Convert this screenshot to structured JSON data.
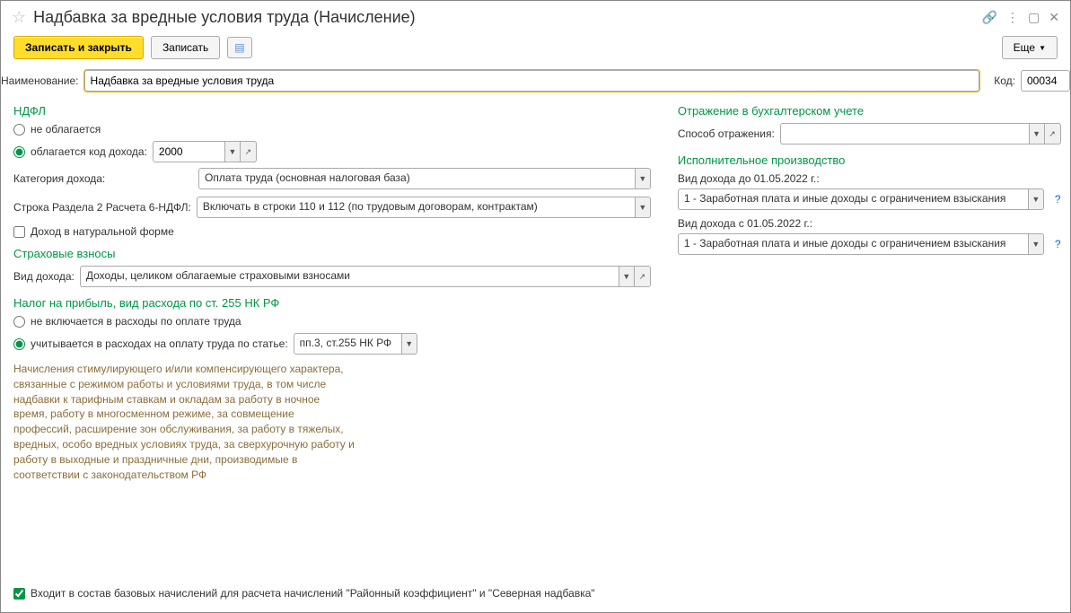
{
  "title": "Надбавка за вредные условия труда (Начисление)",
  "toolbar": {
    "save_close": "Записать и закрыть",
    "save": "Записать",
    "more": "Еще"
  },
  "name_row": {
    "label": "Наименование:",
    "value": "Надбавка за вредные условия труда",
    "code_label": "Код:",
    "code_value": "00034"
  },
  "ndfl": {
    "title": "НДФЛ",
    "opt_exempt": "не облагается",
    "opt_taxed": "облагается   код дохода:",
    "income_code": "2000",
    "category_label": "Категория дохода:",
    "category_value": "Оплата труда (основная налоговая база)",
    "line6_label": "Строка Раздела 2 Расчета 6-НДФЛ:",
    "line6_value": "Включать в строки 110 и 112 (по трудовым договорам, контрактам)",
    "natural_form": "Доход в натуральной форме"
  },
  "contrib": {
    "title": "Страховые взносы",
    "kind_label": "Вид дохода:",
    "kind_value": "Доходы, целиком облагаемые страховыми взносами"
  },
  "profit_tax": {
    "title": "Налог на прибыль, вид расхода по ст. 255 НК РФ",
    "opt_exclude": "не включается в расходы по оплате труда",
    "opt_include": "учитывается в расходах на оплату труда по статье:",
    "article_value": "пп.3, ст.255 НК РФ",
    "hint": "Начисления стимулирующего и/или компенсирующего характера, связанные с режимом работы и условиями труда, в том числе надбавки к тарифным ставкам и окладам за работу в ночное время, работу в многосменном режиме, за совмещение профессий, расширение зон обслуживания, за работу в тяжелых, вредных, особо вредных условиях труда, за сверхурочную работу и работу в выходные и праздничные дни, производимые в соответствии с законодательством РФ"
  },
  "accounting": {
    "title": "Отражение в бухгалтерском учете",
    "method_label": "Способ отражения:",
    "method_value": ""
  },
  "enforce": {
    "title": "Исполнительное производство",
    "before_label": "Вид дохода до 01.05.2022 г.:",
    "before_value": "1 - Заработная плата и иные доходы с ограничением взыскания",
    "after_label": "Вид дохода с 01.05.2022 г.:",
    "after_value": "1 - Заработная плата и иные доходы с ограничением взыскания"
  },
  "footer": {
    "base_check": "Входит в состав базовых начислений для расчета начислений \"Районный коэффициент\" и \"Северная надбавка\""
  }
}
